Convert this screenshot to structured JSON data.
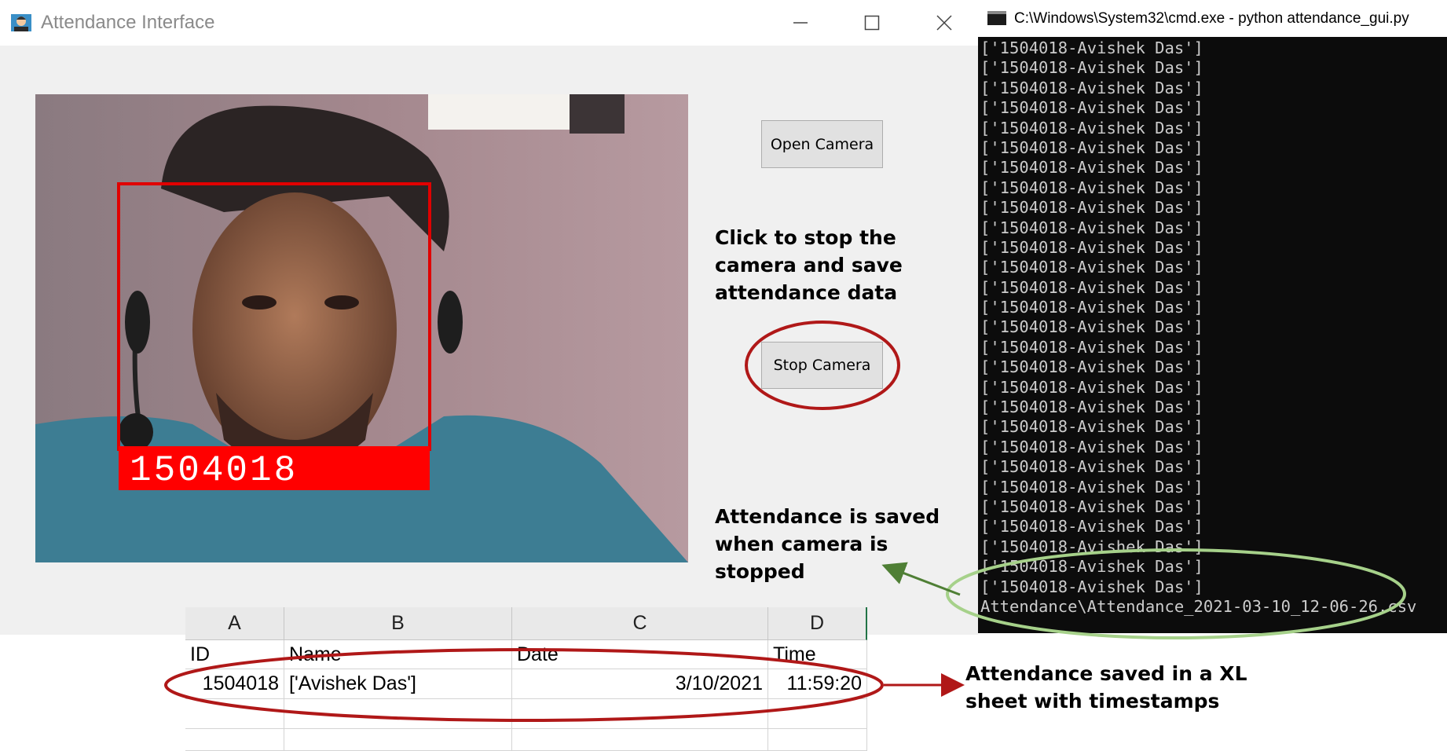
{
  "app_window": {
    "title": "Attendance Interface",
    "open_camera_label": "Open Camera",
    "stop_camera_label": "Stop Camera",
    "detected_id": "1504018"
  },
  "annotations": {
    "stop_note": "Click to stop the camera and save attendance data",
    "saved_note": "Attendance is saved when camera is stopped",
    "xl_note": "Attendance saved in a XL sheet with timestamps"
  },
  "console": {
    "title": "C:\\Windows\\System32\\cmd.exe - python  attendance_gui.py",
    "lines": [
      "['1504018-Avishek Das']",
      "['1504018-Avishek Das']",
      "['1504018-Avishek Das']",
      "['1504018-Avishek Das']",
      "['1504018-Avishek Das']",
      "['1504018-Avishek Das']",
      "['1504018-Avishek Das']",
      "['1504018-Avishek Das']",
      "['1504018-Avishek Das']",
      "['1504018-Avishek Das']",
      "['1504018-Avishek Das']",
      "['1504018-Avishek Das']",
      "['1504018-Avishek Das']",
      "['1504018-Avishek Das']",
      "['1504018-Avishek Das']",
      "['1504018-Avishek Das']",
      "['1504018-Avishek Das']",
      "['1504018-Avishek Das']",
      "['1504018-Avishek Das']",
      "['1504018-Avishek Das']",
      "['1504018-Avishek Das']",
      "['1504018-Avishek Das']",
      "['1504018-Avishek Das']",
      "['1504018-Avishek Das']",
      "['1504018-Avishek Das']",
      "['1504018-Avishek Das']",
      "['1504018-Avishek Das']",
      "['1504018-Avishek Das']",
      "Attendance\\Attendance_2021-03-10_12-06-26.csv"
    ]
  },
  "sheet": {
    "columns": [
      "A",
      "B",
      "C",
      "D"
    ],
    "headers": [
      "ID",
      "Name",
      "Date",
      "Time"
    ],
    "row": [
      "1504018",
      "['Avishek Das']",
      "3/10/2021",
      "11:59:20"
    ]
  },
  "colors": {
    "detection_box": "#e00000",
    "highlight_ellipse": "#b01818",
    "console_highlight": "#a6d18a",
    "arrow_green": "#4f7f35"
  }
}
